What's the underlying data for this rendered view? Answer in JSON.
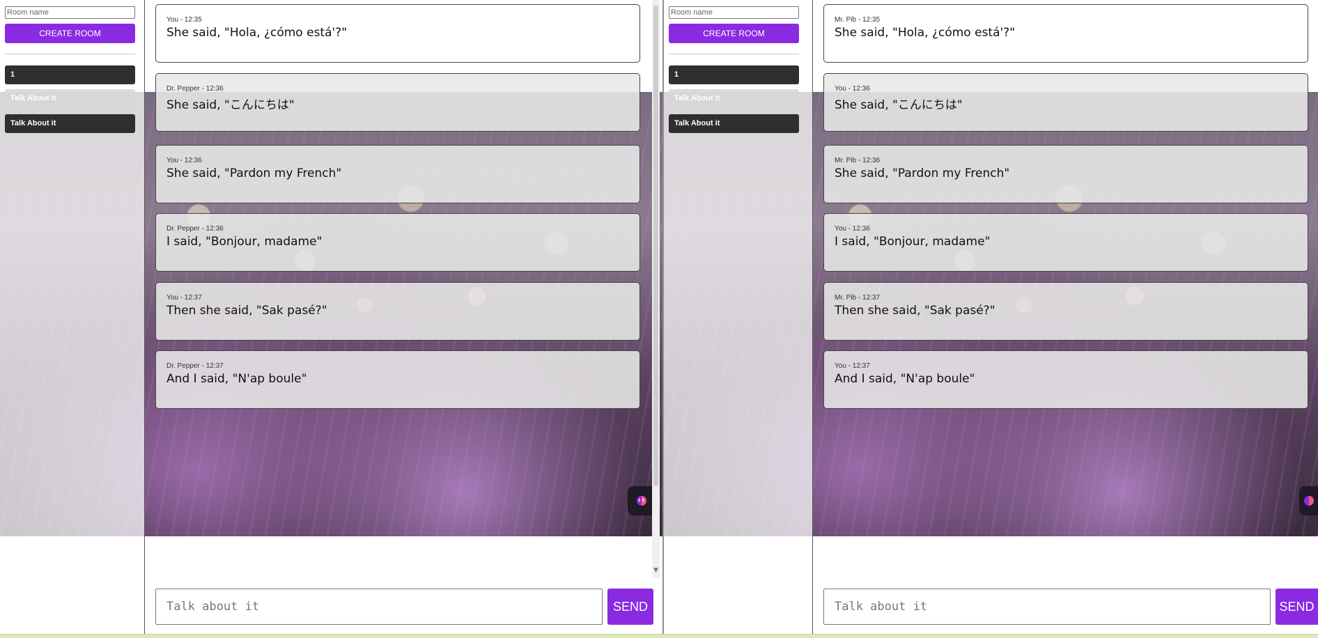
{
  "sidebar": {
    "room_name_placeholder": "Room name",
    "create_room_label": "CREATE ROOM",
    "rooms": [
      {
        "label": "1"
      },
      {
        "label": "Talk About it"
      },
      {
        "label": "Talk About it"
      }
    ]
  },
  "left_chat": {
    "messages": [
      {
        "meta": "You - 12:35",
        "text": "She said, \"Hola, ¿cómo está'?\""
      },
      {
        "meta": "Dr. Pepper - 12:36",
        "text": "She said, \"こんにちは\""
      },
      {
        "meta": "You - 12:36",
        "text": "She said, \"Pardon my French\""
      },
      {
        "meta": "Dr. Pepper - 12:36",
        "text": "I said, \"Bonjour, madame\""
      },
      {
        "meta": "You - 12:37",
        "text": "Then she said, \"Sak pasé?\""
      },
      {
        "meta": "Dr. Pepper - 12:37",
        "text": "And I said, \"N'ap boule\""
      }
    ],
    "input_placeholder": "Talk about it",
    "send_label": "SEND"
  },
  "right_chat": {
    "messages": [
      {
        "meta": "Mr. Pib - 12:35",
        "text": "She said, \"Hola, ¿cómo está'?\""
      },
      {
        "meta": "You - 12:36",
        "text": "She said, \"こんにちは\""
      },
      {
        "meta": "Mr. Pib - 12:36",
        "text": "She said, \"Pardon my French\""
      },
      {
        "meta": "You - 12:36",
        "text": "I said, \"Bonjour, madame\""
      },
      {
        "meta": "Mr. Pib - 12:37",
        "text": "Then she said, \"Sak pasé?\""
      },
      {
        "meta": "You - 12:37",
        "text": "And I said, \"N'ap boule\""
      }
    ],
    "input_placeholder": "Talk about it",
    "send_label": "SEND"
  },
  "icons": {
    "assistant": "brain-icon"
  },
  "colors": {
    "accent": "#8a2be2",
    "room_dark": "#2f2f2f"
  }
}
